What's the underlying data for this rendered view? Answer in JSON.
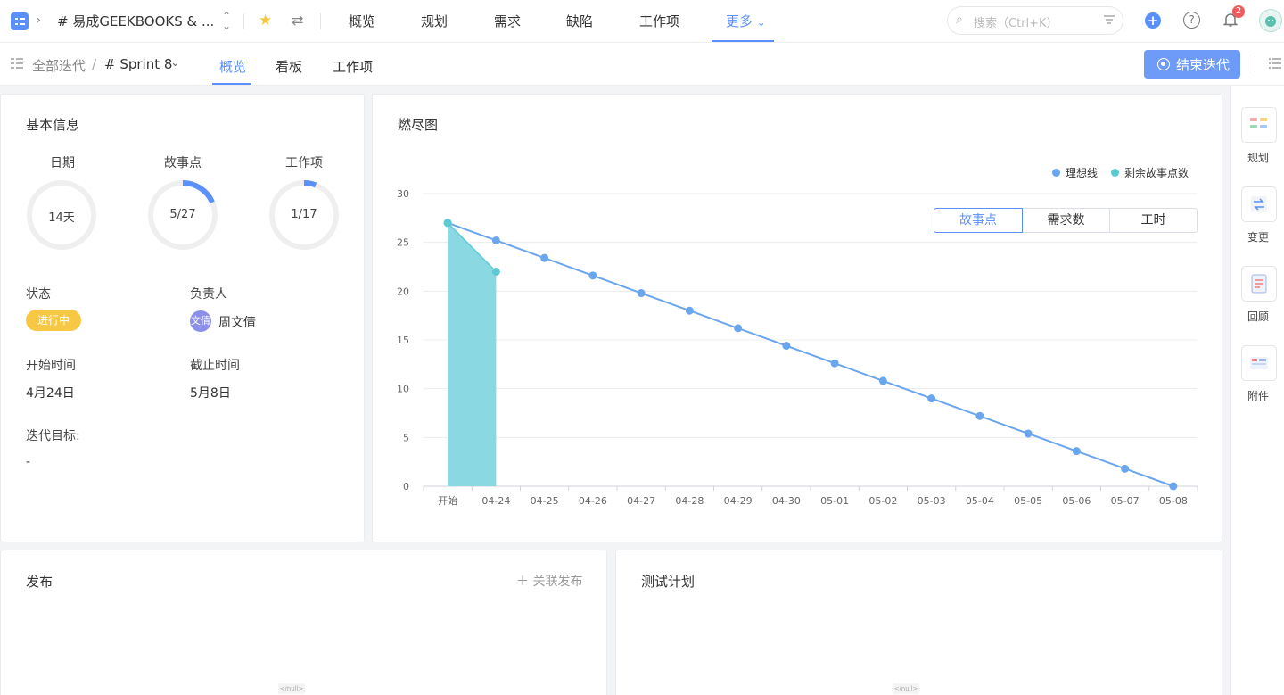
{
  "topbar": {
    "project_name": "# 易成GEEKBOOKS & ...",
    "nav": [
      "概览",
      "规划",
      "需求",
      "缺陷",
      "工作项"
    ],
    "more_label": "更多",
    "search_placeholder": "搜索（Ctrl+K）",
    "notification_count": "2",
    "colors": {
      "accent": "#5b8ff9",
      "badge": "#f05a5a",
      "star": "#f7c844"
    }
  },
  "subbar": {
    "all_iterations": "全部迭代",
    "separator": "/",
    "sprint": "# Sprint 8",
    "tabs": [
      "概览",
      "看板",
      "工作项"
    ],
    "active_tab": "概览",
    "end_button": "结束迭代"
  },
  "basic_info": {
    "title": "基本信息",
    "metrics": [
      {
        "label": "日期",
        "value_text": "14天",
        "progress": 0
      },
      {
        "label": "故事点",
        "value_text": "5/27",
        "progress": 0.185
      },
      {
        "label": "工作项",
        "value_text": "1/17",
        "progress": 0.059
      }
    ],
    "status_label": "状态",
    "status_value": "进行中",
    "status_color": "#f7c844",
    "owner_label": "负责人",
    "owner_avatar_text": "文倩",
    "owner_name": "周文倩",
    "start_label": "开始时间",
    "start_value": "4月24日",
    "end_label": "截止时间",
    "end_value": "5月8日",
    "goal_label": "迭代目标:",
    "goal_value": "-"
  },
  "burndown": {
    "title": "燃尽图",
    "segments": [
      "故事点",
      "需求数",
      "工时"
    ],
    "active_segment": "故事点"
  },
  "chart_data": {
    "type": "line",
    "categories": [
      "开始",
      "04-24",
      "04-25",
      "04-26",
      "04-27",
      "04-28",
      "04-29",
      "04-30",
      "05-01",
      "05-02",
      "05-03",
      "05-04",
      "05-05",
      "05-06",
      "05-07",
      "05-08"
    ],
    "series": [
      {
        "name": "理想线",
        "color": "#6aa6ee",
        "values": [
          27,
          25.2,
          23.4,
          21.6,
          19.8,
          18,
          16.2,
          14.4,
          12.6,
          10.8,
          9,
          7.2,
          5.4,
          3.6,
          1.8,
          0
        ]
      },
      {
        "name": "剩余故事点数",
        "color": "#5ccad3",
        "fill": "#84d6e0",
        "values": [
          27,
          22
        ]
      }
    ],
    "yticks": [
      0,
      5,
      10,
      15,
      20,
      25,
      30
    ],
    "ylim": [
      0,
      30
    ],
    "grid": true,
    "legend_position": "top-right"
  },
  "release": {
    "title": "发布",
    "add_link": "关联发布",
    "empty_text": "</null>"
  },
  "test_plan": {
    "title": "测试计划",
    "empty_text": "</null>"
  },
  "sidebar": {
    "items": [
      {
        "label": "规划",
        "icon": "plan-icon"
      },
      {
        "label": "变更",
        "icon": "change-icon"
      },
      {
        "label": "回顾",
        "icon": "review-icon"
      },
      {
        "label": "附件",
        "icon": "attachment-icon"
      }
    ]
  }
}
